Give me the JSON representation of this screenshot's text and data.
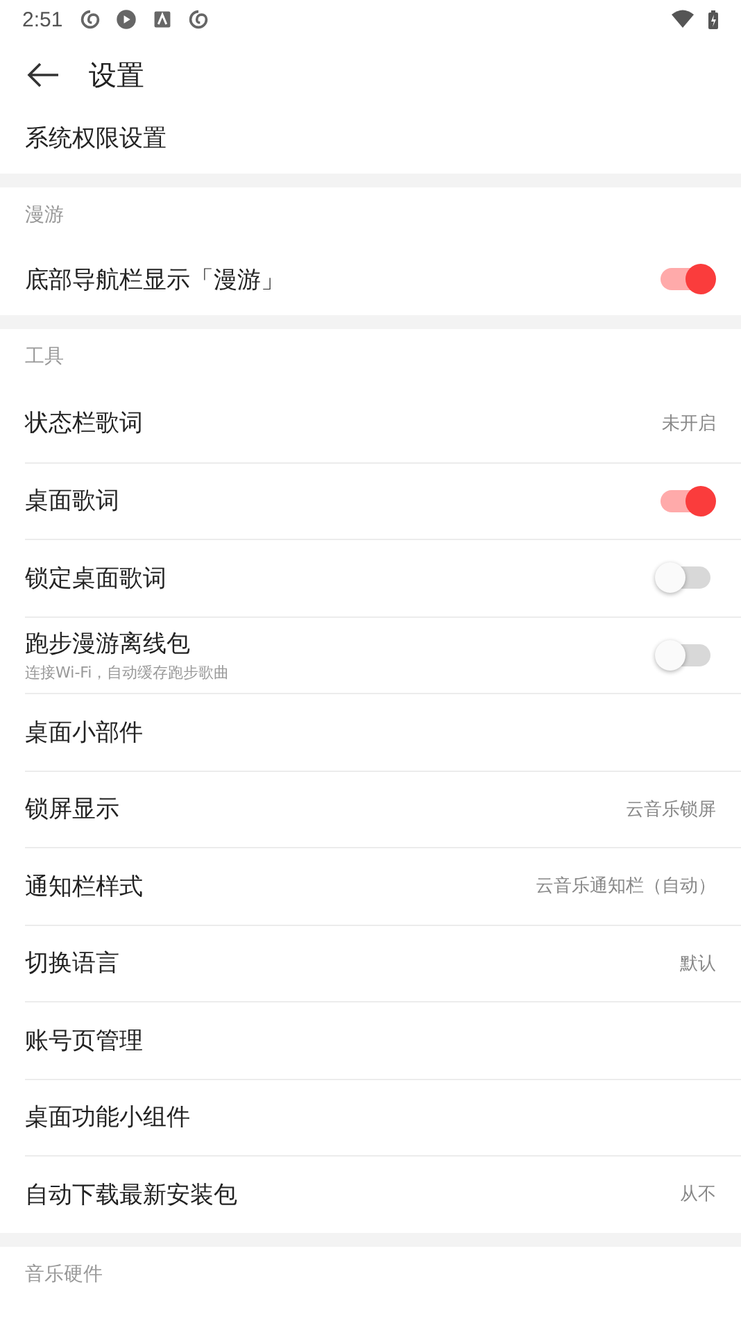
{
  "status_bar": {
    "time": "2:51"
  },
  "header": {
    "title": "设置"
  },
  "sections": [
    {
      "items": [
        {
          "kind": "plain",
          "label": "系统权限设置"
        }
      ]
    },
    {
      "title": "漫游",
      "items": [
        {
          "kind": "toggle",
          "label": "底部导航栏显示「漫游」",
          "on": true
        }
      ]
    },
    {
      "title": "工具",
      "items": [
        {
          "kind": "value",
          "label": "状态栏歌词",
          "value": "未开启"
        },
        {
          "kind": "toggle",
          "label": "桌面歌词",
          "on": true
        },
        {
          "kind": "toggle",
          "label": "锁定桌面歌词",
          "on": false
        },
        {
          "kind": "toggle",
          "label": "跑步漫游离线包",
          "subtitle": "连接Wi-Fi，自动缓存跑步歌曲",
          "on": false
        },
        {
          "kind": "plain",
          "label": "桌面小部件"
        },
        {
          "kind": "value",
          "label": "锁屏显示",
          "value": "云音乐锁屏"
        },
        {
          "kind": "value",
          "label": "通知栏样式",
          "value": "云音乐通知栏（自动）"
        },
        {
          "kind": "value",
          "label": "切换语言",
          "value": "默认"
        },
        {
          "kind": "plain",
          "label": "账号页管理"
        },
        {
          "kind": "plain",
          "label": "桌面功能小组件"
        },
        {
          "kind": "value",
          "label": "自动下载最新安装包",
          "value": "从不"
        }
      ]
    },
    {
      "title": "音乐硬件"
    }
  ]
}
